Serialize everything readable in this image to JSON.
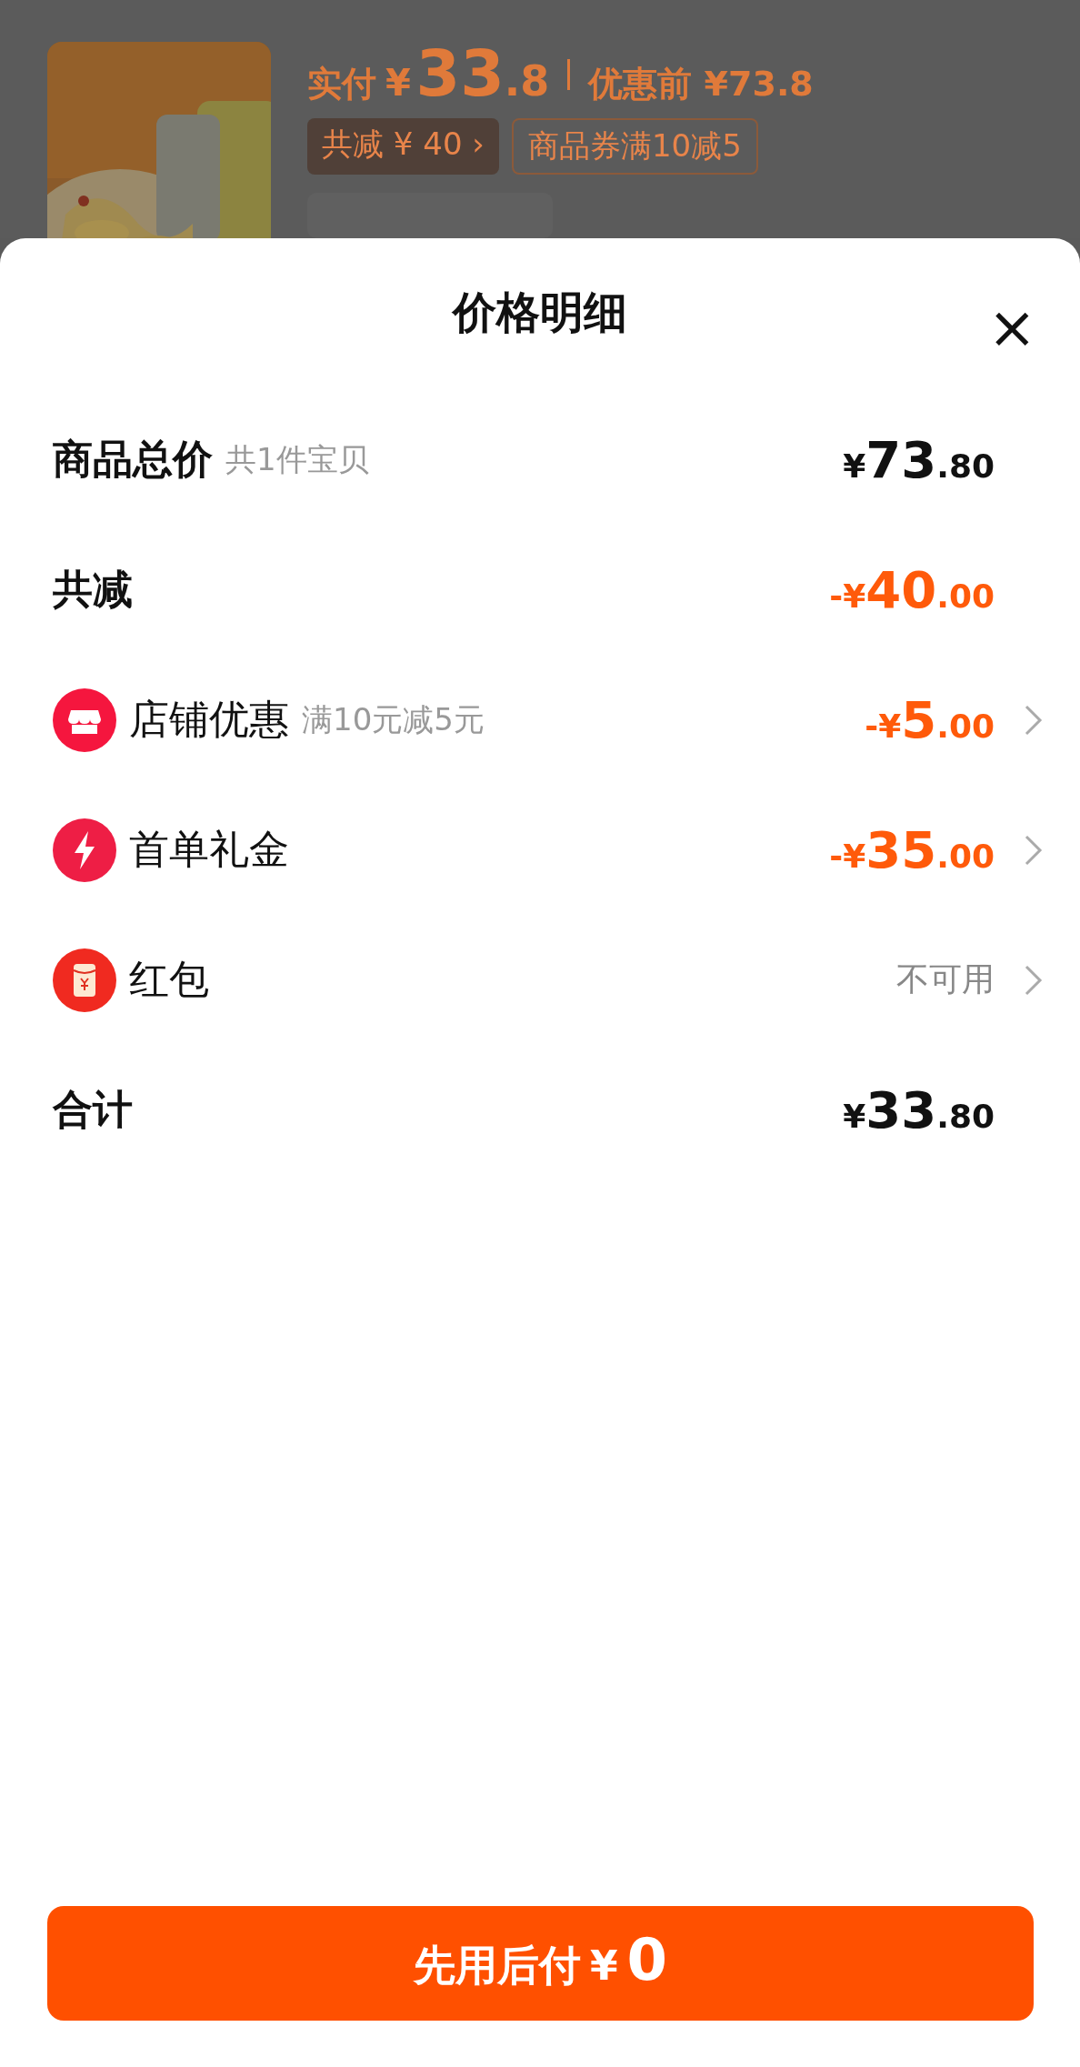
{
  "product": {
    "paid_label": "实付",
    "paid_currency": "¥",
    "paid_main": "33",
    "paid_fraction": ".8",
    "before_label": "优惠前",
    "before_price": "¥73.8",
    "tags": [
      {
        "kind": "filled",
        "text": "共减 ¥ 40",
        "chevron": "›"
      },
      {
        "kind": "outlined",
        "text": "商品券满10减5"
      }
    ]
  },
  "sheet": {
    "title": "价格明细",
    "close": "×",
    "rows": [
      {
        "kind": "total",
        "label": "商品总价",
        "note": "共1件宝贝",
        "amount": {
          "prefix": "¥",
          "main": "73",
          "fraction": ".80"
        }
      },
      {
        "kind": "reduction",
        "label": "共减",
        "amount": {
          "prefix": "-¥",
          "main": "40",
          "fraction": ".00"
        }
      },
      {
        "kind": "shop",
        "label": "店铺优惠",
        "note": "满10元减5元",
        "amount": {
          "prefix": "-¥",
          "main": "5",
          "fraction": ".00"
        }
      },
      {
        "kind": "gift",
        "label": "首单礼金",
        "amount": {
          "prefix": "-¥",
          "main": "35",
          "fraction": ".00"
        }
      },
      {
        "kind": "packet",
        "label": "红包",
        "status": "不可用"
      },
      {
        "kind": "total",
        "label": "合计",
        "amount": {
          "prefix": "¥",
          "main": "33",
          "fraction": ".80"
        }
      }
    ],
    "button": {
      "label": "先用后付",
      "currency": "¥",
      "amount": "0"
    }
  }
}
